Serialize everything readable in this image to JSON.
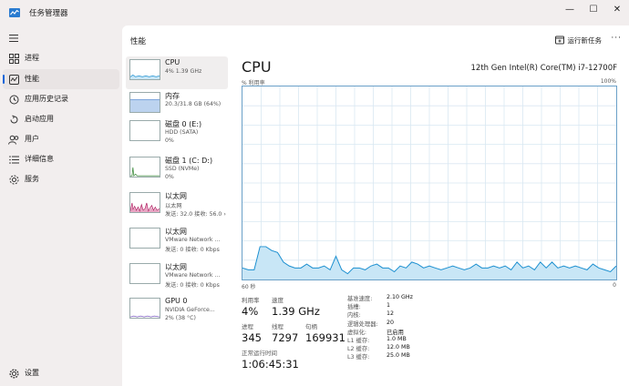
{
  "window": {
    "title": "任务管理器",
    "minimize": "—",
    "maximize": "☐",
    "close": "✕"
  },
  "nav": {
    "items": [
      {
        "label": "进程",
        "icon": "processes-icon"
      },
      {
        "label": "性能",
        "icon": "performance-icon"
      },
      {
        "label": "应用历史记录",
        "icon": "app-history-icon"
      },
      {
        "label": "启动应用",
        "icon": "startup-icon"
      },
      {
        "label": "用户",
        "icon": "users-icon"
      },
      {
        "label": "详细信息",
        "icon": "details-icon"
      },
      {
        "label": "服务",
        "icon": "services-icon"
      }
    ],
    "settings": "设置"
  },
  "header": {
    "title": "性能",
    "run_task": "运行新任务",
    "more": "···"
  },
  "devices": [
    {
      "name": "CPU",
      "sub1": "4% 1.39 GHz",
      "sub2": ""
    },
    {
      "name": "内存",
      "sub1": "20.3/31.8 GB (64%)",
      "sub2": ""
    },
    {
      "name": "磁盘 0 (E:)",
      "sub1": "HDD (SATA)",
      "sub2": "0%"
    },
    {
      "name": "磁盘 1 (C: D:)",
      "sub1": "SSD (NVMe)",
      "sub2": "0%"
    },
    {
      "name": "以太网",
      "sub1": "以太网",
      "sub2": "发送: 32.0 接收: 56.0 ›"
    },
    {
      "name": "以太网",
      "sub1": "VMware Network ...",
      "sub2": "发送: 0 接收: 0 Kbps"
    },
    {
      "name": "以太网",
      "sub1": "VMware Network ...",
      "sub2": "发送: 0 接收: 0 Kbps"
    },
    {
      "name": "GPU 0",
      "sub1": "NVIDIA GeForce...",
      "sub2": "2% (38 °C)"
    }
  ],
  "cpu": {
    "heading": "CPU",
    "model": "12th Gen Intel(R) Core(TM) i7-12700F",
    "util_label": "% 利用率",
    "util_max": "100%",
    "time_left": "60 秒",
    "time_right": "0",
    "stats": {
      "util_k": "利用率",
      "util_v": "4%",
      "speed_k": "速度",
      "speed_v": "1.39 GHz",
      "proc_k": "进程",
      "proc_v": "345",
      "thread_k": "线程",
      "thread_v": "7297",
      "handle_k": "句柄",
      "handle_v": "169931",
      "uptime_k": "正常运行时间",
      "uptime_v": "1:06:45:31"
    },
    "specs": [
      {
        "k": "基准速度:",
        "v": "2.10 GHz"
      },
      {
        "k": "插槽:",
        "v": "1"
      },
      {
        "k": "内核:",
        "v": "12"
      },
      {
        "k": "逻辑处理器:",
        "v": "20"
      },
      {
        "k": "虚拟化:",
        "v": "已启用"
      },
      {
        "k": "L1 缓存:",
        "v": "1.0 MB"
      },
      {
        "k": "L2 缓存:",
        "v": "12.0 MB"
      },
      {
        "k": "L3 缓存:",
        "v": "25.0 MB"
      }
    ],
    "history": [
      6,
      5,
      5,
      17,
      17,
      15,
      14,
      9,
      7,
      6,
      6,
      8,
      6,
      6,
      7,
      5,
      12,
      5,
      3,
      6,
      6,
      5,
      7,
      8,
      6,
      6,
      4,
      7,
      6,
      9,
      8,
      6,
      7,
      6,
      5,
      6,
      7,
      6,
      5,
      6,
      8,
      6,
      6,
      7,
      6,
      7,
      5,
      9,
      6,
      7,
      5,
      9,
      6,
      9,
      6,
      7,
      6,
      7,
      6,
      5,
      8,
      6,
      5,
      4,
      7
    ]
  },
  "colors": {
    "accent": "#0a64d8",
    "cpu_line": "#1b8fd0",
    "cpu_fill": "#c8e6f6",
    "grid": "#d9e8f2",
    "mem_fill": "#bcd3ef",
    "disk1_line": "#3a8a3a",
    "net_line": "#b01c60",
    "gpu_line": "#7b5cc0"
  }
}
